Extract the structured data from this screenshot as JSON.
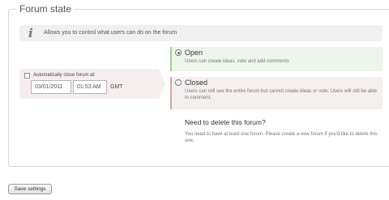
{
  "section": {
    "title": "Forum state"
  },
  "info": {
    "icon": "info-icon",
    "glyph": "i",
    "text": "Allows you to control what users can do on the forum"
  },
  "auto_close": {
    "checkbox_label": "Automatically close forum at:",
    "checked": false,
    "date_value": "03/01/2011",
    "time_value": "01:53 AM",
    "timezone": "GMT"
  },
  "state_options": [
    {
      "title": "Open",
      "description": "Users can create ideas, vote and add comments",
      "selected": true,
      "accent": "#a3d18a"
    },
    {
      "title": "Closed",
      "description": "Users can still see the entire forum but cannot create ideas or vote. Users will still be able to comment.",
      "selected": false,
      "accent": "#d7a7a7"
    }
  ],
  "delete": {
    "title": "Need to delete this forum?",
    "description": "You need to have at least one forum. Please create a new forum if you'd like to delete this one."
  },
  "actions": {
    "save_label": "Save settings"
  }
}
